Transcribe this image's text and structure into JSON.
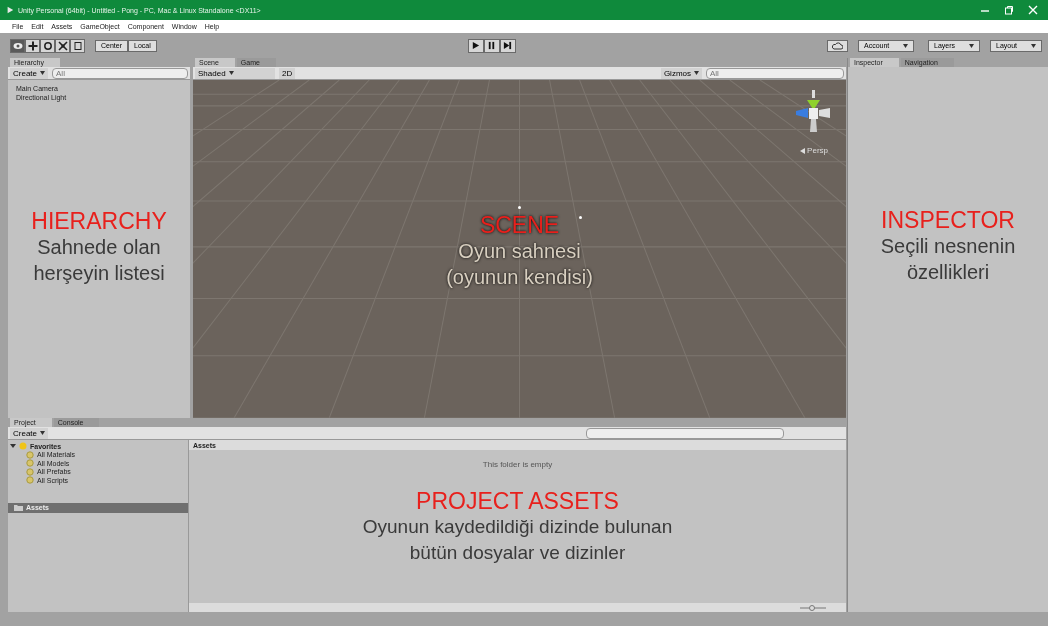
{
  "window": {
    "title": "Unity Personal (64bit) - Untitled - Pong - PC, Mac & Linux Standalone <DX11>"
  },
  "menu": [
    "File",
    "Edit",
    "Assets",
    "GameObject",
    "Component",
    "Window",
    "Help"
  ],
  "tools": [
    {
      "kind": "view",
      "selected": true
    },
    {
      "kind": "move",
      "selected": false
    },
    {
      "kind": "rotate",
      "selected": false
    },
    {
      "kind": "scale",
      "selected": false
    },
    {
      "kind": "rect",
      "selected": false
    }
  ],
  "pivot_buttons": [
    "Center",
    "Local"
  ],
  "account_button": "Account",
  "layers_button": "Layers",
  "layout_button": "Layout",
  "hierarchy": {
    "tab": "Hierarchy",
    "create": "Create",
    "search_placeholder": "All",
    "items": [
      "Main Camera",
      "Directional Light"
    ],
    "annotation": {
      "title": "HIERARCHY",
      "lines": [
        "Sahnede olan",
        "herşeyin listesi"
      ]
    }
  },
  "scene": {
    "tabs": [
      {
        "label": "Scene",
        "selected": true
      },
      {
        "label": "Game",
        "selected": false
      }
    ],
    "shading": "Shaded",
    "mode_2d": "2D",
    "gizmos": "Gizmos",
    "search_placeholder": "All",
    "persp": "Persp",
    "annotation": {
      "title": "SCENE",
      "lines": [
        "Oyun sahnesi",
        "(oyunun kendisi)"
      ]
    }
  },
  "inspector": {
    "tabs": [
      {
        "label": "Inspector",
        "selected": true
      },
      {
        "label": "Navigation",
        "selected": false
      }
    ],
    "annotation": {
      "title": "INSPECTOR",
      "lines": [
        "Seçili nesnenin",
        "özellikleri"
      ]
    }
  },
  "project": {
    "tabs": [
      {
        "label": "Project",
        "selected": true
      },
      {
        "label": "Console",
        "selected": false
      }
    ],
    "create": "Create",
    "favorites": {
      "label": "Favorites",
      "expanded": true,
      "children": [
        "All Materials",
        "All Models",
        "All Prefabs",
        "All Scripts"
      ]
    },
    "assets_folder": {
      "label": "Assets",
      "selected": true
    },
    "breadcrumb": "Assets",
    "empty_message": "This folder is empty",
    "annotation": {
      "title": "PROJECT ASSETS",
      "lines": [
        "Oyunun kaydedildiği dizinde bulunan",
        "bütün dosyalar ve dizinler"
      ]
    }
  }
}
